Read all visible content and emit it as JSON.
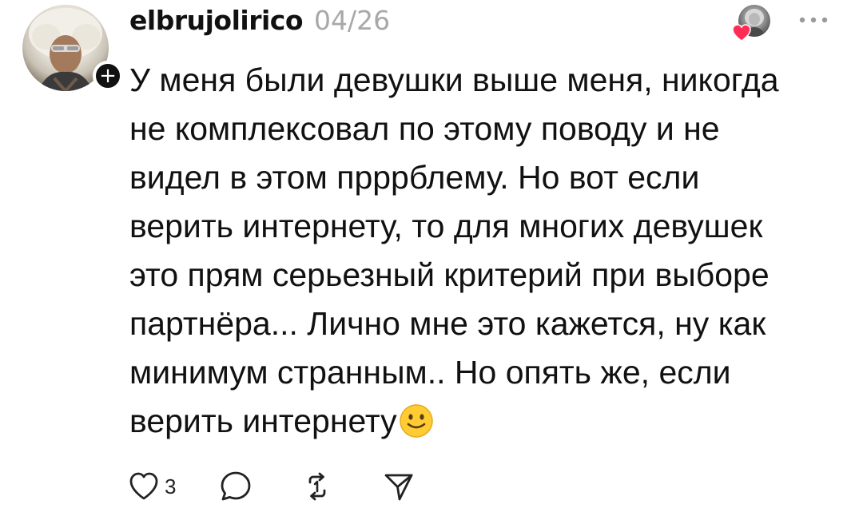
{
  "post": {
    "username": "elbrujolirico",
    "date": "04/26",
    "follow_symbol": "+",
    "body_text": "У меня были девушки выше меня, никогда\nне комплексовал по этому поводу и не\nвидел в этом прррблему. Но вот если\nверить интернету, то для многих девушек\nэто прям серьезный критерий при выборе\nпартнёра... Лично мне это кажется, ну как\nминимум странным.. Но опять же, если\nверить интернету",
    "emoji": "slightly-smiling-face",
    "like_count": "3"
  },
  "icons": {
    "more": "more-horizontal-icon",
    "like": "heart-icon",
    "comment": "comment-bubble-icon",
    "repost": "repost-icon",
    "share": "send-icon",
    "liked_by_heart": "heart-filled-icon"
  },
  "colors": {
    "text": "#111111",
    "muted": "#a8a8a8",
    "liked_heart": "#ff2d55",
    "emoji_face": "#ffcc33"
  }
}
